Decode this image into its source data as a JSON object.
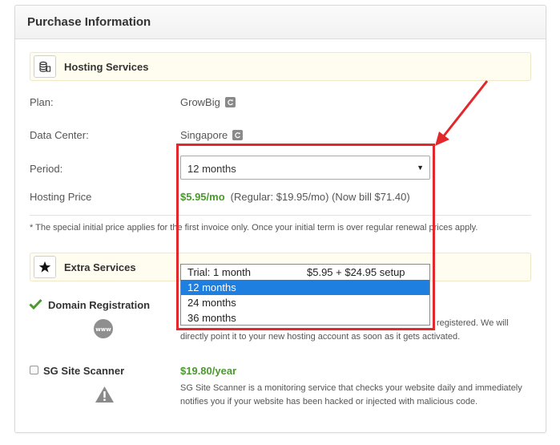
{
  "panel": {
    "title": "Purchase Information"
  },
  "hosting": {
    "section_title": "Hosting Services",
    "icon": "database-stack-icon",
    "plan": {
      "label": "Plan:",
      "value": "GrowBig"
    },
    "data_center": {
      "label": "Data Center:",
      "value": "Singapore"
    },
    "period": {
      "label": "Period:",
      "selected": "12 months"
    },
    "price": {
      "label": "Hosting Price",
      "amount": "$5.95/mo",
      "details": "(Regular: $19.95/mo) (Now bill $71.40)"
    },
    "note": "* The special initial price applies for the first invoice only. Once your initial term is over regular renewal prices apply."
  },
  "dropdown": {
    "options": [
      {
        "label": "Trial: 1 month",
        "extra": "$5.95 + $24.95 setup"
      },
      {
        "label": "12 months",
        "extra": ""
      },
      {
        "label": "24 months",
        "extra": ""
      },
      {
        "label": "36 months",
        "extra": ""
      }
    ],
    "selected_index": 1
  },
  "extra": {
    "section_title": "Extra Services",
    "icon": "star-icon",
    "domain": {
      "title": "Domain Registration",
      "icon": "www-globe-icon",
      "desc_line1": "registered. We will",
      "desc_line2": "directly point it to your new hosting account as soon as it gets activated."
    },
    "scanner": {
      "title": "SG Site Scanner",
      "price": "$19.80/year",
      "icon": "warning-triangle-icon",
      "desc_line1": "SG Site Scanner is a monitoring service that checks your website daily and immediately",
      "desc_line2": "notifies you if your website has been hacked or injected with malicious code."
    }
  },
  "colors": {
    "accent_green": "#4a9a2e",
    "highlight_red": "#e2272d",
    "selected_blue": "#1e7fe0"
  }
}
